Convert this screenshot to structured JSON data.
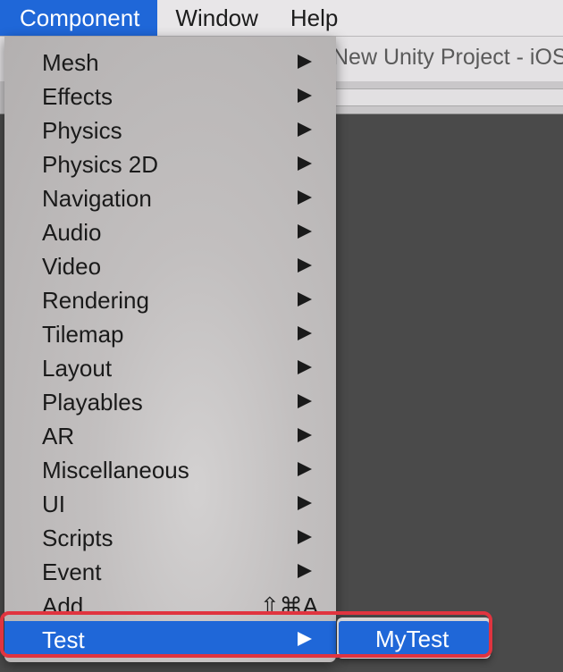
{
  "menubar": {
    "items": [
      "Component",
      "Window",
      "Help"
    ],
    "active": "Component"
  },
  "editor": {
    "title": "New Unity Project - iOS"
  },
  "component_menu": {
    "items": [
      {
        "label": "Mesh",
        "has_submenu": true
      },
      {
        "label": "Effects",
        "has_submenu": true
      },
      {
        "label": "Physics",
        "has_submenu": true
      },
      {
        "label": "Physics 2D",
        "has_submenu": true
      },
      {
        "label": "Navigation",
        "has_submenu": true
      },
      {
        "label": "Audio",
        "has_submenu": true
      },
      {
        "label": "Video",
        "has_submenu": true
      },
      {
        "label": "Rendering",
        "has_submenu": true
      },
      {
        "label": "Tilemap",
        "has_submenu": true
      },
      {
        "label": "Layout",
        "has_submenu": true
      },
      {
        "label": "Playables",
        "has_submenu": true
      },
      {
        "label": "AR",
        "has_submenu": true
      },
      {
        "label": "Miscellaneous",
        "has_submenu": true
      },
      {
        "label": "UI",
        "has_submenu": true
      },
      {
        "label": "Scripts",
        "has_submenu": true
      },
      {
        "label": "Event",
        "has_submenu": true
      },
      {
        "label": "Add...",
        "shortcut": "⇧⌘A"
      },
      {
        "label": "Test",
        "has_submenu": true,
        "selected": true
      }
    ]
  },
  "test_submenu": {
    "items": [
      "MyTest"
    ]
  },
  "colors": {
    "selection": "#1f67d8",
    "highlight_border": "#e0343f"
  }
}
